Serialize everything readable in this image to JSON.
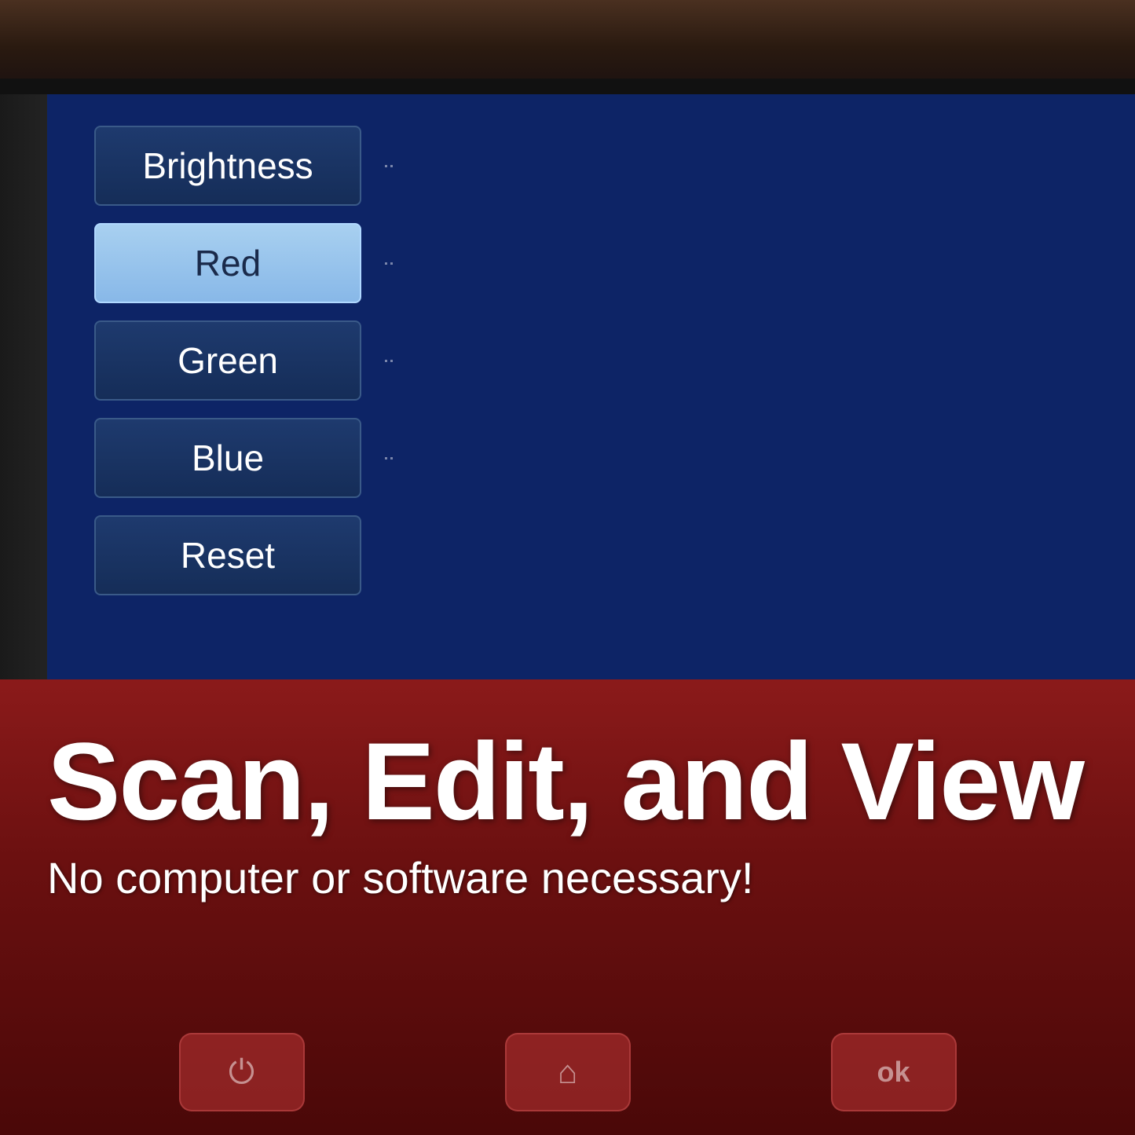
{
  "device": {
    "colors": {
      "screen_bg": "#0d2466",
      "device_frame": "#1a1a1a",
      "top_bezel": "#3a2510",
      "bottom_bg_top": "#8b1a1a",
      "bottom_bg_bottom": "#4a0808"
    }
  },
  "screen": {
    "menu_items": [
      {
        "id": "brightness",
        "label": "Brightness",
        "style": "normal"
      },
      {
        "id": "red",
        "label": "Red",
        "style": "selected"
      },
      {
        "id": "green",
        "label": "Green",
        "style": "normal"
      },
      {
        "id": "blue",
        "label": "Blue",
        "style": "normal"
      },
      {
        "id": "reset",
        "label": "Reset",
        "style": "normal"
      }
    ]
  },
  "bottom": {
    "headline": "Scan, Edit, and View",
    "subheadline": "No computer or software necessary!",
    "buttons": [
      {
        "id": "power",
        "icon": "⏻",
        "label": "power-button"
      },
      {
        "id": "home",
        "icon": "⌂",
        "label": "home-button"
      },
      {
        "id": "ok",
        "icon": "ok",
        "label": "ok-button"
      }
    ]
  }
}
